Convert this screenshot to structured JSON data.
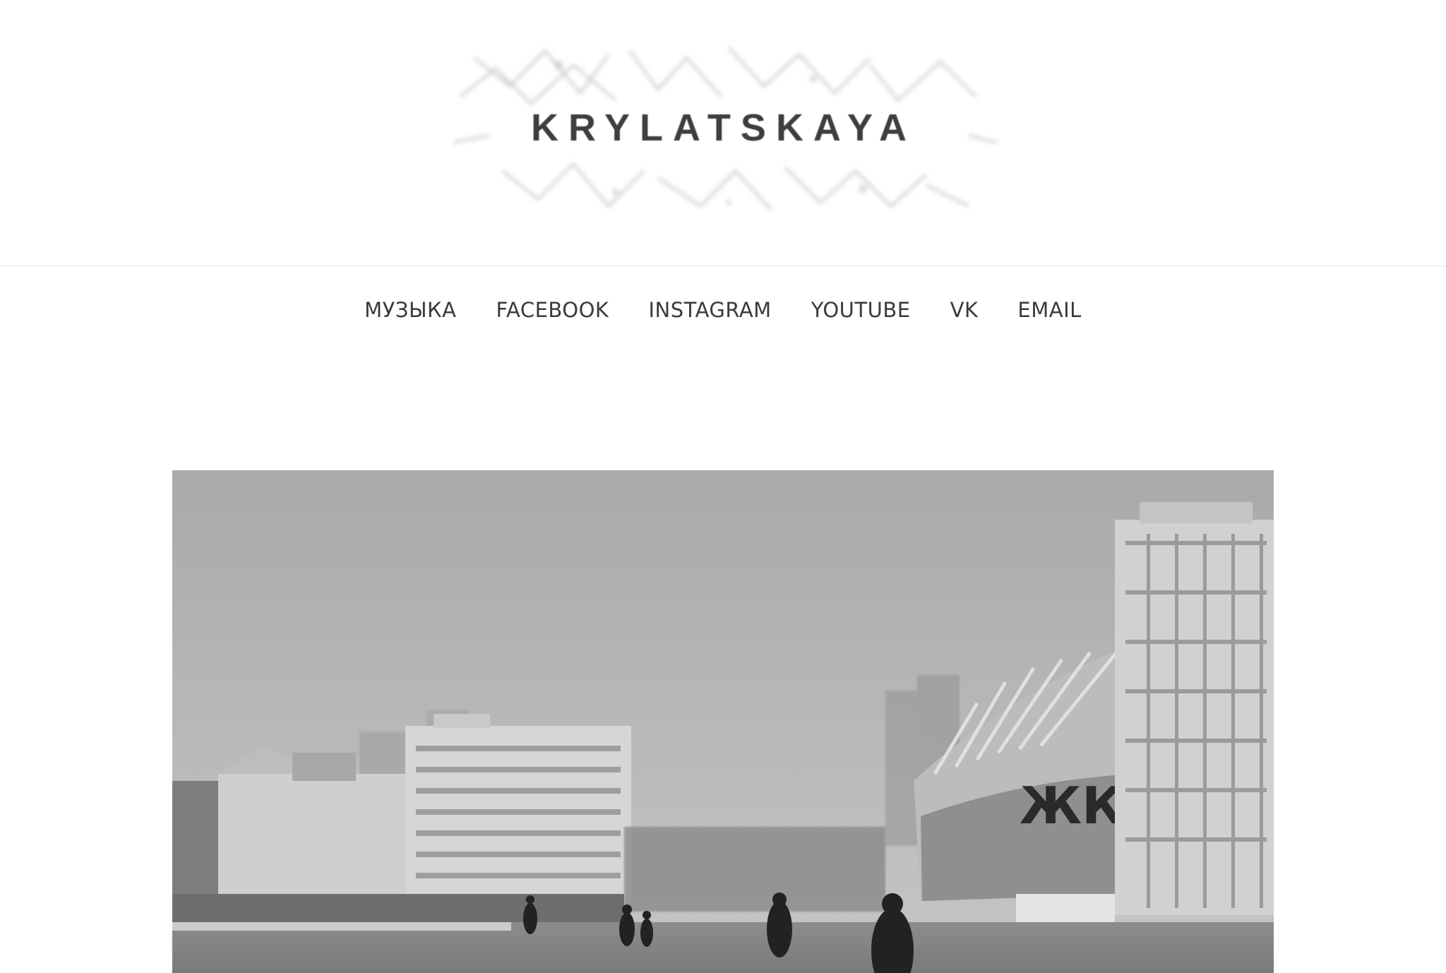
{
  "site": {
    "logo_text": "KRYLATSKAYA"
  },
  "nav": {
    "items": [
      {
        "label": "МУЗЫКА"
      },
      {
        "label": "FACEBOOK"
      },
      {
        "label": "INSTAGRAM"
      },
      {
        "label": "YOUTUBE"
      },
      {
        "label": "VK"
      },
      {
        "label": "EMAIL"
      }
    ]
  },
  "hero_image": {
    "stadium_letters": "ЖК"
  },
  "colors": {
    "background": "#ffffff",
    "nav_text": "#3a3a3a",
    "logo_text": "#3e3e3e",
    "divider": "#e5e5e5"
  }
}
